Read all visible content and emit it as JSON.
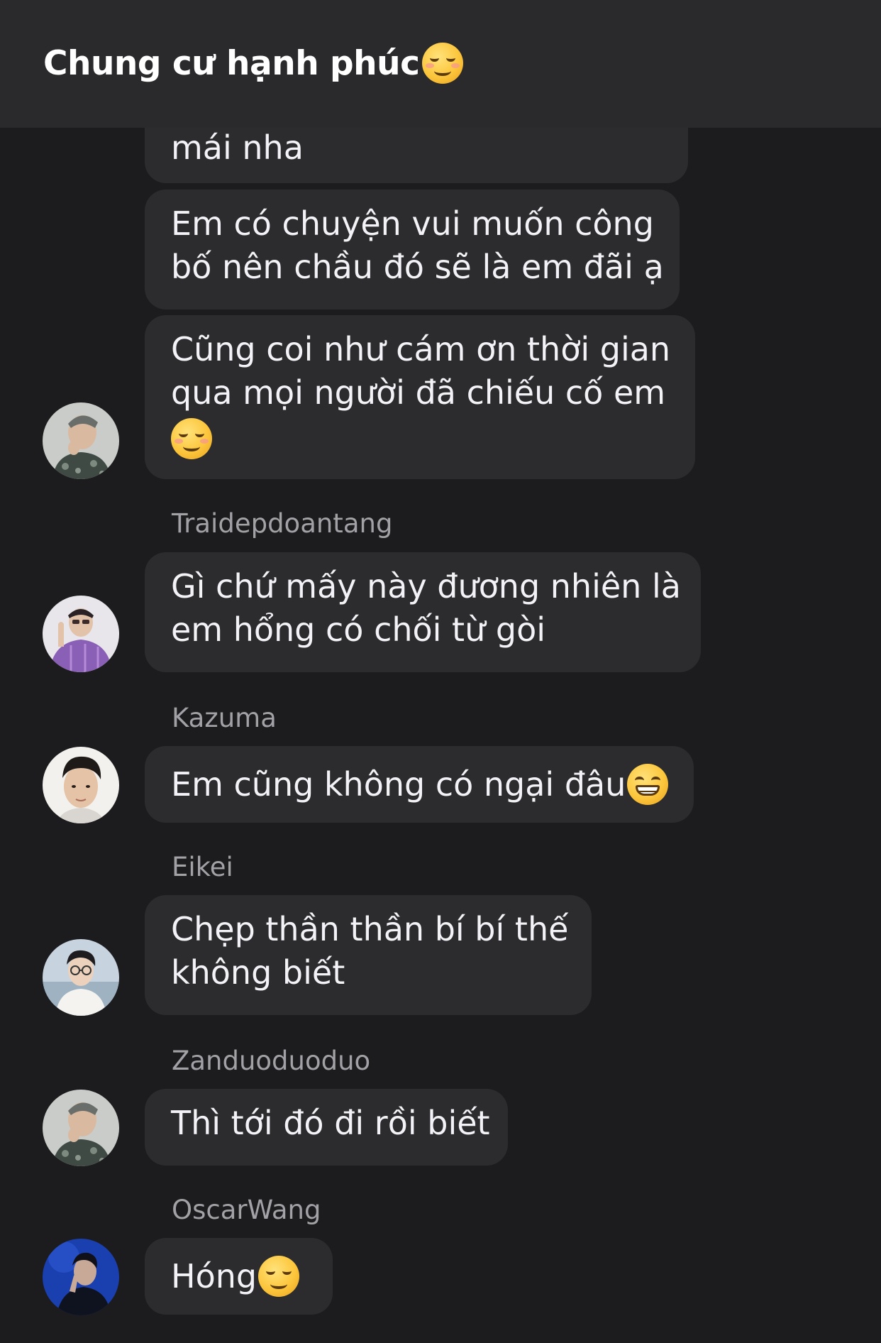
{
  "header": {
    "title": "Chung cư hạnh phúc",
    "title_emoji": "smiling-face-icon"
  },
  "messages": [
    {
      "lines": [
        "mái nha"
      ],
      "avatar": null
    },
    {
      "lines": [
        "Em có chuyện vui muốn công",
        "bố nên chầu đó sẽ là em đãi ạ"
      ],
      "avatar": null
    },
    {
      "lines": [
        "Cũng coi như cám ơn thời gian",
        "qua mọi người đã chiếu cố em"
      ],
      "trailing_emoji": "smiling-face-icon",
      "avatar": "avatar-patterned-shirt"
    },
    {
      "sender": "Traidepdoantang",
      "lines": [
        "Gì chứ mấy này đương nhiên là",
        "em hổng có chối từ gòi"
      ],
      "avatar": "avatar-purple-shirt"
    },
    {
      "sender": "Kazuma",
      "lines": [
        "Em cũng không có ngại đâu"
      ],
      "trailing_emoji": "grinning-face-icon",
      "avatar": "avatar-white-background"
    },
    {
      "sender": "Eikei",
      "lines": [
        "Chẹp thần thần bí bí thế",
        "không biết"
      ],
      "avatar": "avatar-glasses"
    },
    {
      "sender": "Zanduoduoduo",
      "lines": [
        "Thì tới đó đi rồi biết"
      ],
      "avatar": "avatar-patterned-shirt"
    },
    {
      "sender": "OscarWang",
      "lines": [
        "Hóng"
      ],
      "trailing_emoji": "relieved-face-icon",
      "avatar": "avatar-blue-background"
    }
  ],
  "colors": {
    "background": "#1c1c1e",
    "header": "#2a2a2c",
    "bubble": "#2c2c2e",
    "text": "#f2f2f7",
    "sender": "#a1a1a6"
  }
}
